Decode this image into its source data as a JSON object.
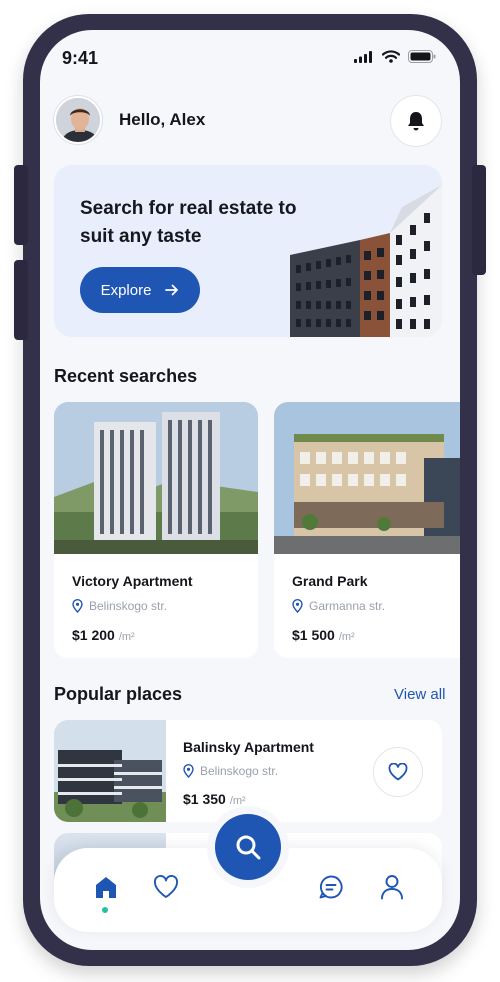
{
  "status_bar": {
    "time": "9:41"
  },
  "header": {
    "greeting": "Hello, Alex"
  },
  "banner": {
    "headline": "Search for real estate to suit any taste",
    "button_label": "Explore"
  },
  "recent": {
    "title": "Recent searches",
    "items": [
      {
        "name": "Victory Apartment",
        "address": "Belinskogo str.",
        "price": "$1 200",
        "unit": "/m²"
      },
      {
        "name": "Grand Park",
        "address": "Garmanna str.",
        "price": "$1 500",
        "unit": "/m²"
      }
    ]
  },
  "popular": {
    "title": "Popular places",
    "view_all": "View all",
    "items": [
      {
        "name": "Balinsky Apartment",
        "address": "Belinskogo str.",
        "price": "$1 350",
        "unit": "/m²"
      }
    ]
  },
  "colors": {
    "accent": "#1f55b3",
    "background": "#f6f7fb",
    "frame": "#33304a",
    "indicator": "#22c29a"
  },
  "tab_bar": {
    "items": [
      "home-icon",
      "heart-icon",
      "search-icon",
      "chat-icon",
      "profile-icon"
    ],
    "active": "home-icon"
  }
}
